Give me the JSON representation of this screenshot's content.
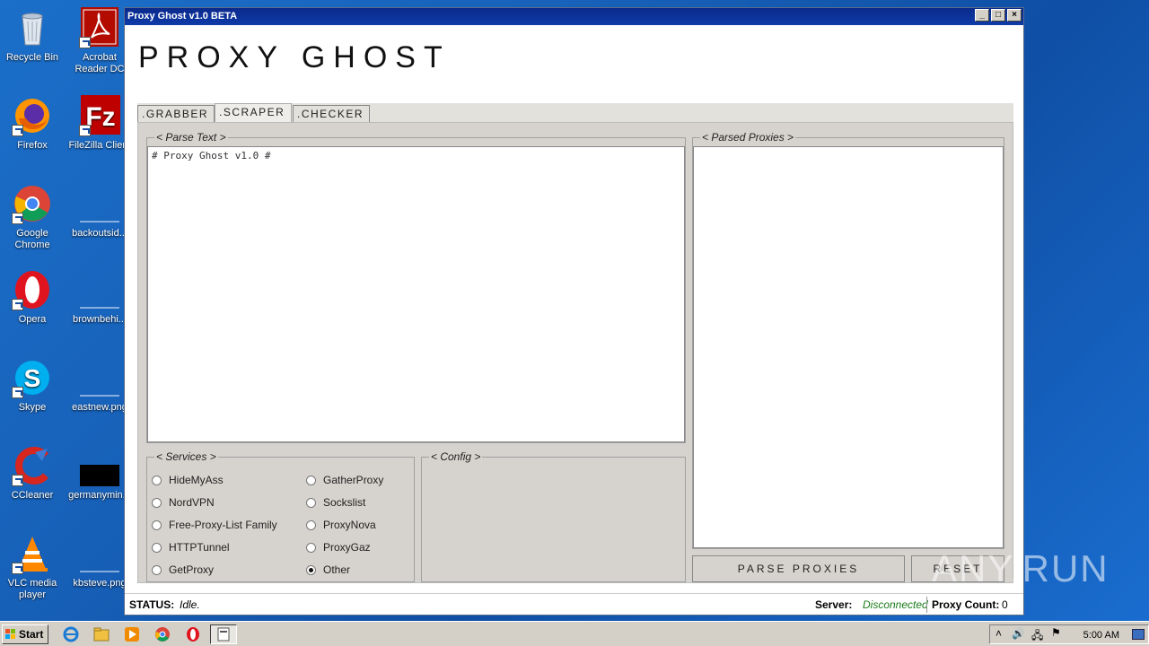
{
  "desktop": {
    "icons_col1": [
      {
        "label": "Recycle Bin",
        "icon": "recycle-bin-icon"
      },
      {
        "label": "Firefox",
        "icon": "firefox-icon"
      },
      {
        "label": "Google Chrome",
        "icon": "chrome-icon"
      },
      {
        "label": "Opera",
        "icon": "opera-icon"
      },
      {
        "label": "Skype",
        "icon": "skype-icon"
      },
      {
        "label": "CCleaner",
        "icon": "ccleaner-icon"
      },
      {
        "label": "VLC media player",
        "icon": "vlc-icon"
      }
    ],
    "icons_col2": [
      {
        "label": "Acrobat Reader DC",
        "icon": "acrobat-icon"
      },
      {
        "label": "FileZilla Client",
        "icon": "filezilla-icon"
      },
      {
        "label": "backoutsid...",
        "icon": "file-icon"
      },
      {
        "label": "brownbehi...",
        "icon": "file-icon"
      },
      {
        "label": "eastnew.png",
        "icon": "file-icon"
      },
      {
        "label": "germanymin...",
        "icon": "file-icon"
      },
      {
        "label": "kbsteve.png",
        "icon": "file-icon"
      }
    ]
  },
  "window": {
    "title": "Proxy Ghost v1.0 BETA",
    "app_heading": "PROXY GHOST",
    "tabs": [
      {
        "label": ".GRABBER",
        "active": false
      },
      {
        "label": ".SCRAPER",
        "active": true
      },
      {
        "label": ".CHECKER",
        "active": false
      }
    ],
    "parse_text": {
      "legend": "< Parse Text >",
      "content": "# Proxy Ghost v1.0 #"
    },
    "parsed_proxies": {
      "legend": "< Parsed Proxies >",
      "content": ""
    },
    "services": {
      "legend": "< Services >",
      "col1": [
        {
          "label": "HideMyAss",
          "selected": false
        },
        {
          "label": "NordVPN",
          "selected": false
        },
        {
          "label": "Free-Proxy-List Family",
          "selected": false
        },
        {
          "label": "HTTPTunnel",
          "selected": false
        },
        {
          "label": "GetProxy",
          "selected": false
        }
      ],
      "col2": [
        {
          "label": "GatherProxy",
          "selected": false
        },
        {
          "label": "Sockslist",
          "selected": false
        },
        {
          "label": "ProxyNova",
          "selected": false
        },
        {
          "label": "ProxyGaz",
          "selected": false
        },
        {
          "label": "Other",
          "selected": true
        }
      ]
    },
    "config": {
      "legend": "< Config >"
    },
    "buttons": {
      "parse": "PARSE PROXIES",
      "reset": "RESET"
    },
    "status": {
      "label": "STATUS:",
      "value": "Idle.",
      "server_label": "Server:",
      "server_value": "Disconnected",
      "count_label": "Proxy Count:",
      "count_value": "0"
    }
  },
  "watermark": "ANY.RUN",
  "taskbar": {
    "start_label": "Start",
    "clock": "5:00 AM"
  }
}
